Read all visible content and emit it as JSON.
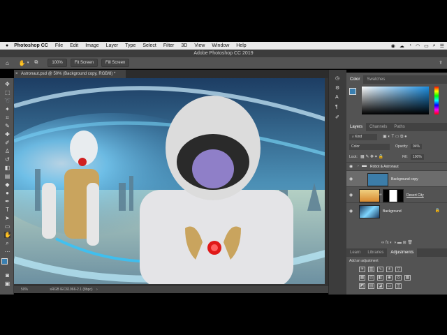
{
  "menubar": {
    "items": [
      "Photoshop CC",
      "File",
      "Edit",
      "Image",
      "Layer",
      "Type",
      "Select",
      "Filter",
      "3D",
      "View",
      "Window",
      "Help"
    ]
  },
  "window": {
    "title": "Adobe Photoshop CC 2019"
  },
  "options": {
    "zoom": "100%",
    "fit_screen": "Fit Screen",
    "fill_screen": "Fill Screen"
  },
  "document": {
    "tab_title": "Astronaut.psd @ 50% (Background copy, RGB/8) *"
  },
  "status": {
    "zoom": "50%",
    "profile": "sRGB IEC61966-2.1 (8bpc)"
  },
  "color_panel": {
    "tabs": [
      "Color",
      "Swatches"
    ],
    "colors": {
      "fg": "#3a7fb0",
      "bg": "#d9d9d9"
    }
  },
  "layers_panel": {
    "tabs": [
      "Layers",
      "Channels",
      "Paths"
    ],
    "kind": "Kind",
    "blend_mode": "Color",
    "opacity_label": "Opacity:",
    "opacity_value": "94%",
    "lock_label": "Lock:",
    "fill_label": "Fill:",
    "fill_value": "100%",
    "layers": [
      {
        "name": "Robot & Astronaut",
        "type": "group"
      },
      {
        "name": "Background copy",
        "type": "fill",
        "color": "#3c7da9",
        "selected": true
      },
      {
        "name": "Desert City",
        "type": "masked"
      },
      {
        "name": "Background",
        "type": "image",
        "locked": true
      }
    ]
  },
  "adjustments_panel": {
    "tabs": [
      "Learn",
      "Libraries",
      "Adjustments"
    ],
    "add_label": "Add an adjustment"
  }
}
